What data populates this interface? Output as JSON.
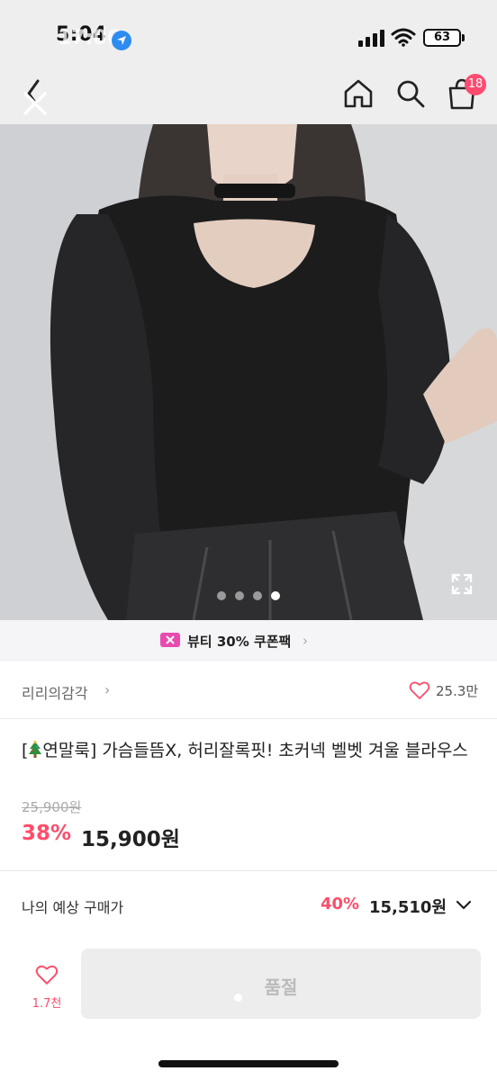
{
  "status_bar": {
    "time": "5:04",
    "time_overlay": "17:06",
    "battery": "63"
  },
  "nav": {
    "cart_badge": "18",
    "icons": [
      "back-icon",
      "close-icon",
      "home-icon",
      "search-icon",
      "cart-icon"
    ]
  },
  "gallery": {
    "page_count": 4,
    "active_index": 3
  },
  "coupon": {
    "label": "뷰티 30% 쿠폰팩",
    "chevron": "›"
  },
  "seller": {
    "name": "리리의감각",
    "chevron": "›",
    "likes": "25.3만"
  },
  "product": {
    "title_prefix": "[",
    "title_rest": "연말룩] 가슴들뜸X, 허리잘록핏! 초커넥 벨벳 겨울 블라우스",
    "original_price": "25,900원",
    "discount": "38%",
    "price": "15,900원"
  },
  "expected": {
    "label": "나의 예상 구매가",
    "discount": "40%",
    "price": "15,510원"
  },
  "bottom_bar": {
    "like_count": "1.7천",
    "soldout_label": "품절"
  },
  "colors": {
    "accent": "#ff4d6a",
    "coupon": "#e84bb0",
    "badge": "#ff4b6e"
  }
}
